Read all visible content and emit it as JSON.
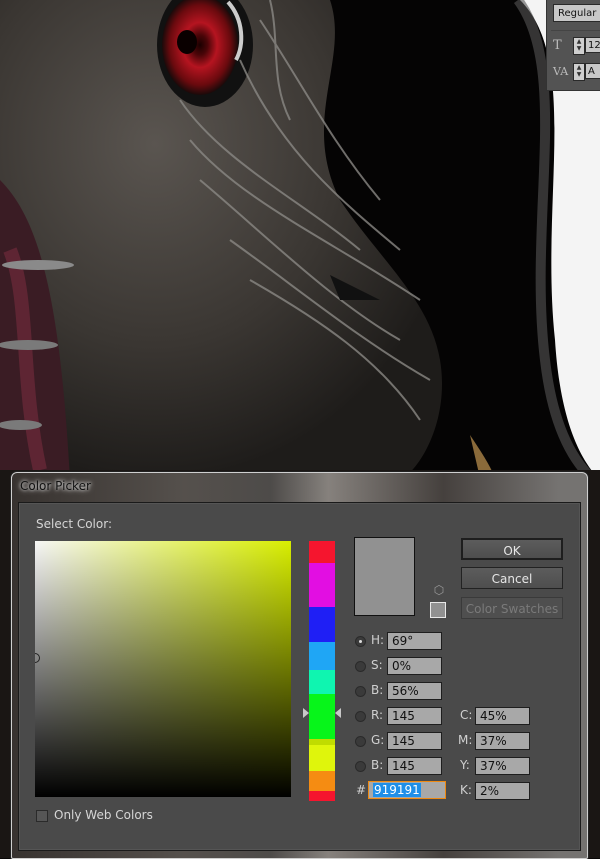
{
  "dialog": {
    "title": "Color Picker",
    "select_color_label": "Select Color:",
    "buttons": {
      "ok": "OK",
      "cancel": "Cancel",
      "color_swatches": "Color Swatches"
    },
    "current_color_hex": "#919191",
    "hue_base_color": "#d8ee00",
    "fields": {
      "hsb": [
        {
          "label": "H:",
          "value": "69°",
          "selected": true
        },
        {
          "label": "S:",
          "value": "0%",
          "selected": false
        },
        {
          "label": "B:",
          "value": "56%",
          "selected": false
        }
      ],
      "rgb": [
        {
          "label": "R:",
          "value": "145",
          "selected": false
        },
        {
          "label": "G:",
          "value": "145",
          "selected": false
        },
        {
          "label": "B:",
          "value": "145",
          "selected": false
        }
      ],
      "cmyk": [
        {
          "label": "C:",
          "value": "45%"
        },
        {
          "label": "M:",
          "value": "37%"
        },
        {
          "label": "Y:",
          "value": "37%"
        },
        {
          "label": "K:",
          "value": "2%"
        }
      ],
      "hex_label": "#",
      "hex_value": "919191"
    },
    "hue_slider": {
      "colors": [
        "#f5152e",
        "#e20ee2",
        "#1f1ff5",
        "#1fa6f5",
        "#0ff5b0",
        "#07f51a",
        "#c0dc00",
        "#dff50c",
        "#f58c12",
        "#f5152e"
      ],
      "hue_value_deg": 69
    },
    "only_web_colors": {
      "label": "Only Web Colors",
      "checked": false
    },
    "icons": {
      "gamut": "cube-icon",
      "websafe": "websafe-swatch"
    }
  },
  "character_panel": {
    "font_style": "Regular",
    "size_value": "12",
    "tracking_value": "A",
    "size_icon": "font-size-icon",
    "tracking_icon": "tracking-icon"
  }
}
